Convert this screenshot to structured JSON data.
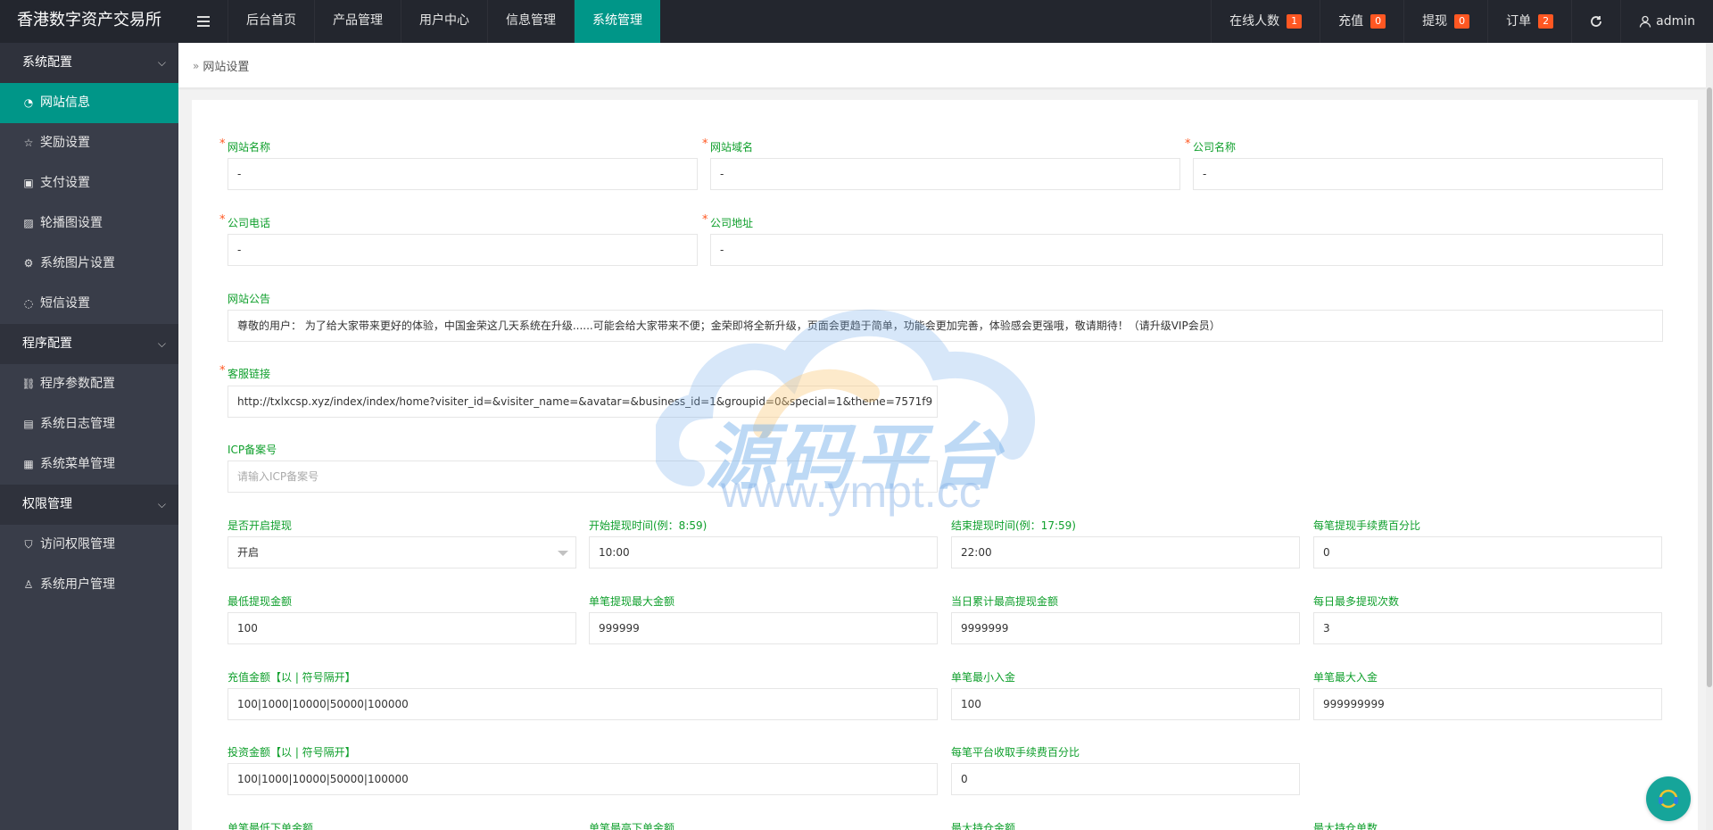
{
  "header": {
    "logo": "香港数字资产交易所",
    "menu_toggle_icon": "menu-icon",
    "nav": [
      {
        "label": "后台首页"
      },
      {
        "label": "产品管理"
      },
      {
        "label": "用户中心"
      },
      {
        "label": "信息管理"
      },
      {
        "label": "系统管理"
      }
    ],
    "active_nav": "系统管理",
    "right": {
      "online_label": "在线人数",
      "online_count": "1",
      "recharge_label": "充值",
      "recharge_count": "0",
      "withdraw_label": "提现",
      "withdraw_count": "0",
      "order_label": "订单",
      "order_count": "2",
      "refresh_icon": "refresh-icon",
      "user_name": "admin"
    }
  },
  "sidebar": {
    "groups": [
      {
        "label": "系统配置",
        "items": [
          "网站信息",
          "奖励设置",
          "支付设置",
          "轮播图设置",
          "系统图片设置",
          "短信设置"
        ]
      },
      {
        "label": "程序配置",
        "items": [
          "程序参数配置",
          "系统日志管理",
          "系统菜单管理"
        ]
      },
      {
        "label": "权限管理",
        "items": [
          "访问权限管理",
          "系统用户管理"
        ]
      }
    ],
    "active_item": "网站信息"
  },
  "breadcrumb": {
    "current": "网站设置"
  },
  "form": {
    "site_name": {
      "label": "网站名称",
      "value": "-"
    },
    "site_domain": {
      "label": "网站域名",
      "value": "-"
    },
    "company_name": {
      "label": "公司名称",
      "value": "-"
    },
    "company_phone": {
      "label": "公司电话",
      "value": "-"
    },
    "company_address": {
      "label": "公司地址",
      "value": "-"
    },
    "announcement": {
      "label": "网站公告",
      "value": "尊敬的用户： 为了给大家带来更好的体验，中国金荣这几天系统在升级......可能会给大家带来不便；金荣即将全新升级，页面会更趋于简单，功能会更加完善，体验感会更强哦，敬请期待！（请升级VIP会员）"
    },
    "service_link": {
      "label": "客服链接",
      "value": "http://txlxcsp.xyz/index/index/home?visiter_id=&visiter_name=&avatar=&business_id=1&groupid=0&special=1&theme=7571f9"
    },
    "icp": {
      "label": "ICP备案号",
      "placeholder": "请输入ICP备案号"
    },
    "withdraw_enabled": {
      "label": "是否开启提现",
      "value": "开启"
    },
    "withdraw_start": {
      "label": "开始提现时间(例：8:59)",
      "value": "10:00"
    },
    "withdraw_end": {
      "label": "结束提现时间(例：17:59)",
      "value": "22:00"
    },
    "withdraw_fee": {
      "label": "每笔提现手续费百分比",
      "value": "0"
    },
    "min_withdraw": {
      "label": "最低提现金额",
      "value": "100"
    },
    "max_withdraw_single": {
      "label": "单笔提现最大金额",
      "value": "999999"
    },
    "max_withdraw_daily": {
      "label": "当日累计最高提现金额",
      "value": "9999999"
    },
    "max_withdraw_times": {
      "label": "每日最多提现次数",
      "value": "3"
    },
    "recharge_amounts": {
      "label": "充值金额【以 | 符号隔开】",
      "value": "100|1000|10000|50000|100000"
    },
    "min_deposit": {
      "label": "单笔最小入金",
      "value": "100"
    },
    "max_deposit": {
      "label": "单笔最大入金",
      "value": "999999999"
    },
    "invest_amounts": {
      "label": "投资金额【以 | 符号隔开】",
      "value": "100|1000|10000|50000|100000"
    },
    "platform_fee": {
      "label": "每笔平台收取手续费百分比",
      "value": "0"
    },
    "min_order": {
      "label": "单笔最低下单金额"
    },
    "max_order": {
      "label": "单笔最高下单金额"
    },
    "max_position": {
      "label": "最大持仓金额"
    },
    "max_orders": {
      "label": "最大持仓单数"
    }
  },
  "watermark": {
    "title": "源码平台",
    "url": "www.ympt.cc"
  },
  "colors": {
    "accent": "#009688",
    "header_bg": "#23262e",
    "sidebar_bg": "#393d49",
    "badge": "#ff5722",
    "label_green": "#0e9f2b"
  }
}
